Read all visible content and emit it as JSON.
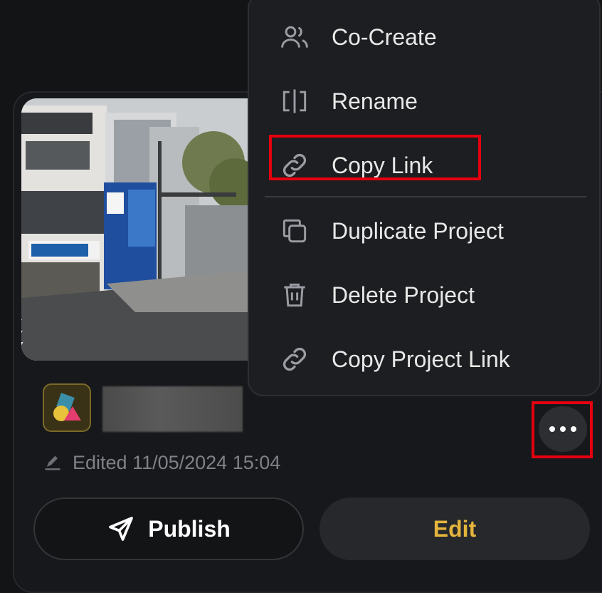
{
  "menu": {
    "items": [
      {
        "label": "Co-Create",
        "icon": "users-icon"
      },
      {
        "label": "Rename",
        "icon": "rename-icon"
      },
      {
        "label": "Copy Link",
        "icon": "link-icon"
      },
      {
        "label": "Duplicate Project",
        "icon": "duplicate-icon"
      },
      {
        "label": "Delete Project",
        "icon": "trash-icon"
      },
      {
        "label": "Copy Project Link",
        "icon": "link-icon"
      }
    ]
  },
  "card": {
    "edited": "Edited 11/05/2024 15:04",
    "publish_label": "Publish",
    "edit_label": "Edit"
  },
  "colors": {
    "accent": "#e4b43c",
    "highlight": "#e5000f",
    "background": "#131416"
  }
}
